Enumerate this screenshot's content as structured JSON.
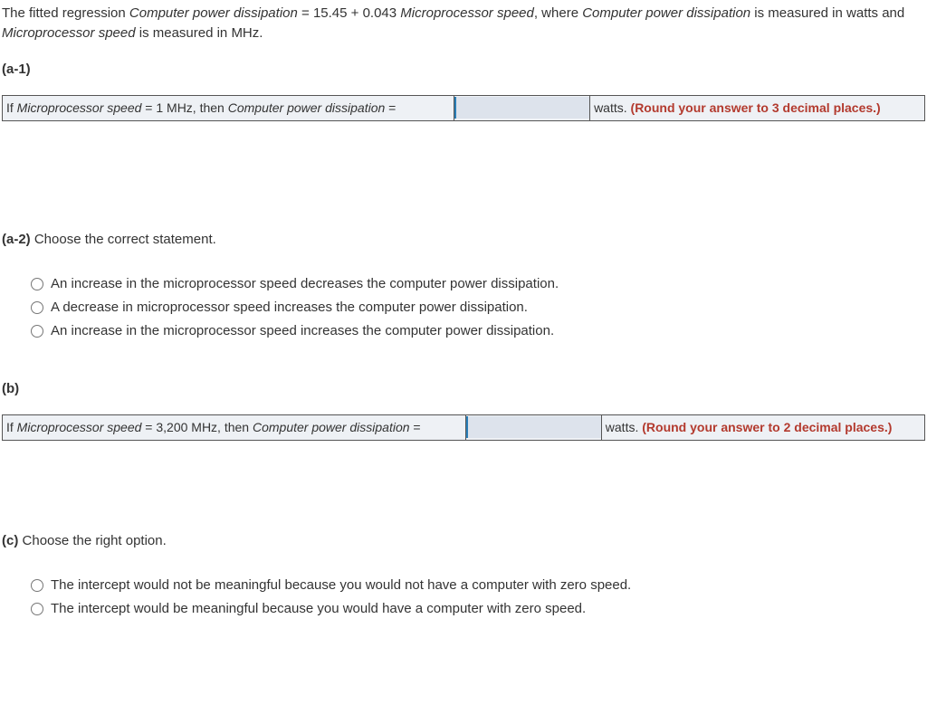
{
  "intro": {
    "pre": "The fitted regression ",
    "var1": "Computer power dissipation",
    "eq_mid": " = 15.45 + 0.043 ",
    "var2": "Microprocessor speed",
    "post1": ", where ",
    "var3": "Computer power dissipation",
    "post2": " is measured in watts and ",
    "var4": "Microprocessor speed",
    "post3": " is measured in MHz."
  },
  "a1": {
    "label": "(a-1)",
    "promptPrefix": "If ",
    "promptVar1": "Microprocessor speed",
    "promptMid1": " = 1 MHz, then ",
    "promptVar2": "Computer power dissipation",
    "promptMid2": " =",
    "suffixText": "watts. ",
    "rounding": "(Round your answer to 3 decimal places.)",
    "inputValue": ""
  },
  "a2": {
    "label": "(a-2)",
    "instr": "Choose the correct statement.",
    "options": [
      "An increase in the microprocessor speed decreases the computer power dissipation.",
      "A decrease in microprocessor speed increases the computer power dissipation.",
      "An increase in the microprocessor speed increases the computer power dissipation."
    ]
  },
  "b": {
    "label": "(b)",
    "promptPrefix": "If ",
    "promptVar1": "Microprocessor speed",
    "promptMid1": " = 3,200 MHz, then ",
    "promptVar2": "Computer power dissipation",
    "promptMid2": " =",
    "suffixText": "watts. ",
    "rounding": "(Round your answer to 2 decimal places.)",
    "inputValue": ""
  },
  "c": {
    "label": "(c)",
    "instr": "Choose the right option.",
    "options": [
      "The intercept would not be meaningful because you would not have a computer with zero speed.",
      "The intercept would be meaningful because you would have a computer with zero speed."
    ]
  }
}
